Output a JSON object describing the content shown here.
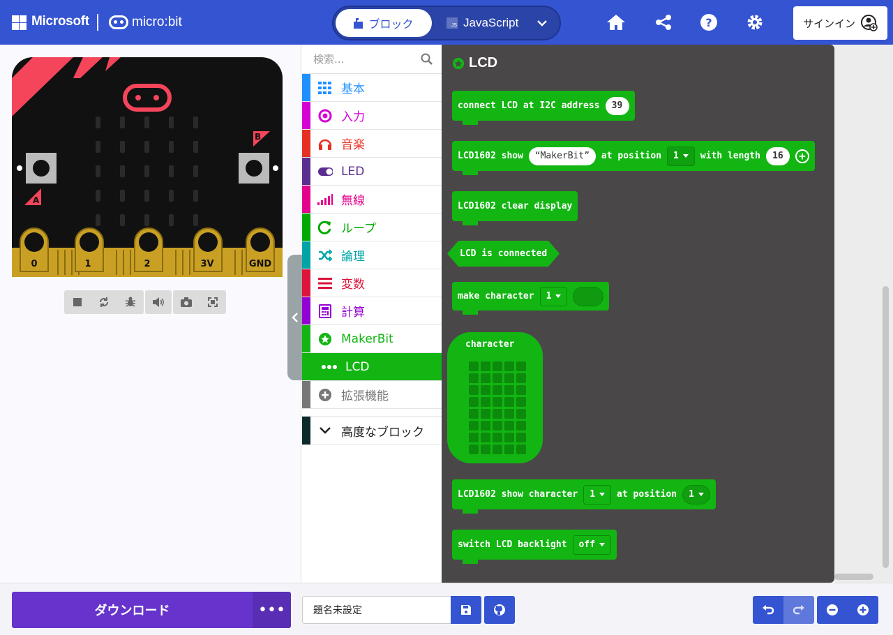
{
  "header": {
    "microsoft_label": "Microsoft",
    "microbit_label": "micro:bit",
    "blocks_tab": "ブロック",
    "javascript_tab": "JavaScript",
    "js_badge": "JS",
    "signin_label": "サインイン",
    "accent_color": "#3454d1"
  },
  "simulator": {
    "pins": [
      "0",
      "1",
      "2",
      "3V",
      "GND"
    ],
    "button_a": "A",
    "button_b": "B"
  },
  "toolbox": {
    "search_placeholder": "検索...",
    "categories": [
      {
        "label": "基本",
        "color": "#1e90ff",
        "icon": "grid-icon"
      },
      {
        "label": "入力",
        "color": "#d400d4",
        "icon": "circle-icon"
      },
      {
        "label": "音楽",
        "color": "#e63022",
        "icon": "headphones-icon"
      },
      {
        "label": "LED",
        "color": "#5c2d91",
        "icon": "toggle-icon"
      },
      {
        "label": "無線",
        "color": "#e3008c",
        "icon": "signal-icon"
      },
      {
        "label": "ループ",
        "color": "#00aa00",
        "icon": "refresh-icon"
      },
      {
        "label": "論理",
        "color": "#00a4a6",
        "icon": "shuffle-icon"
      },
      {
        "label": "変数",
        "color": "#dc143c",
        "icon": "list-icon"
      },
      {
        "label": "計算",
        "color": "#9400d3",
        "icon": "calculator-icon"
      },
      {
        "label": "MakerBit",
        "color": "#13b513",
        "icon": "star-circle-icon"
      },
      {
        "label": "LCD",
        "color": "#13b513",
        "icon": "dots-icon"
      },
      {
        "label": "拡張機能",
        "color": "#777777",
        "icon": "plus-circle-icon"
      }
    ],
    "advanced_label": "高度なブロック"
  },
  "flyout": {
    "title": "LCD",
    "blocks": {
      "connect": {
        "text": "connect LCD at I2C address",
        "value": "39"
      },
      "show": {
        "text1": "LCD1602 show",
        "string": "MakerBit",
        "text2": "at position",
        "pos": "1",
        "text3": "with length",
        "len": "16"
      },
      "clear": {
        "text": "LCD1602 clear display"
      },
      "connected": {
        "text": "LCD is connected"
      },
      "make": {
        "text": "make character",
        "value": "1"
      },
      "character": {
        "text": "character"
      },
      "show_char": {
        "text1": "LCD1602 show character",
        "value": "1",
        "text2": "at position",
        "pos": "1"
      },
      "backlight": {
        "text": "switch LCD backlight",
        "value": "off"
      }
    }
  },
  "footer": {
    "download_label": "ダウンロード",
    "more_label": "•••",
    "project_name": "題名未設定"
  }
}
